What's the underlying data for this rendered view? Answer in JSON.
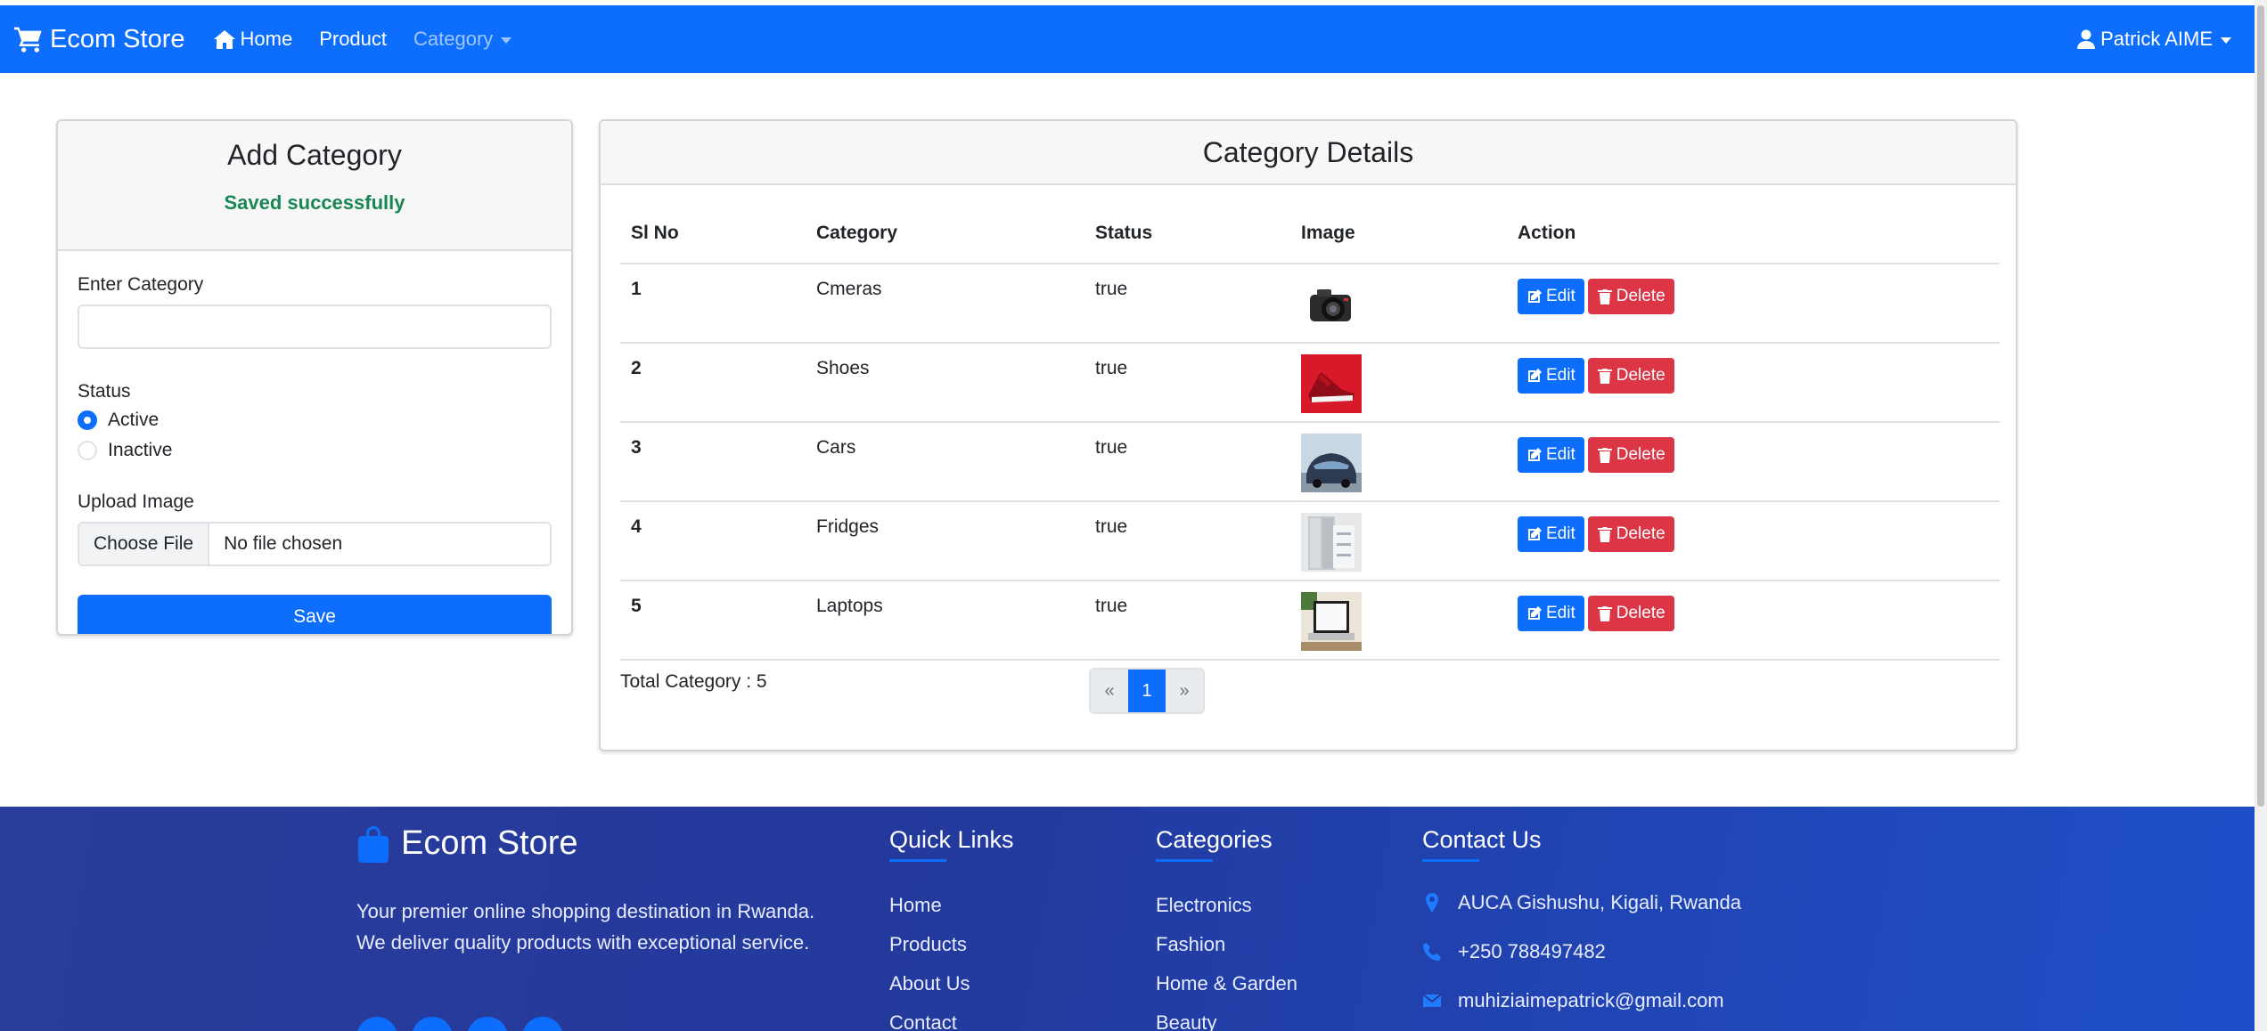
{
  "navbar": {
    "brand": "Ecom Store",
    "links": [
      {
        "label": "Home"
      },
      {
        "label": "Product"
      },
      {
        "label": "Category"
      }
    ],
    "user": "Patrick AIME"
  },
  "add_category": {
    "title": "Add Category",
    "message": "Saved successfully",
    "category_label": "Enter Category",
    "category_value": "",
    "status_label": "Status",
    "status_options": [
      "Active",
      "Inactive"
    ],
    "status_selected": "Active",
    "upload_label": "Upload Image",
    "file_button": "Choose File",
    "file_text": "No file chosen",
    "save_label": "Save"
  },
  "category_details": {
    "title": "Category Details",
    "columns": [
      "Sl No",
      "Category",
      "Status",
      "Image",
      "Action"
    ],
    "rows": [
      {
        "sl": "1",
        "category": "Cmeras",
        "status": "true",
        "image": "camera"
      },
      {
        "sl": "2",
        "category": "Shoes",
        "status": "true",
        "image": "shoe"
      },
      {
        "sl": "3",
        "category": "Cars",
        "status": "true",
        "image": "car"
      },
      {
        "sl": "4",
        "category": "Fridges",
        "status": "true",
        "image": "fridge"
      },
      {
        "sl": "5",
        "category": "Laptops",
        "status": "true",
        "image": "laptop"
      }
    ],
    "edit_label": "Edit",
    "delete_label": "Delete",
    "total_text": "Total Category : 5",
    "pagination": {
      "prev": "«",
      "current": "1",
      "next": "»"
    }
  },
  "footer": {
    "brand": "Ecom Store",
    "description": "Your premier online shopping destination in Rwanda. We deliver quality products with exceptional service.",
    "quick_links_title": "Quick Links",
    "quick_links": [
      "Home",
      "Products",
      "About Us",
      "Contact"
    ],
    "categories_title": "Categories",
    "categories": [
      "Electronics",
      "Fashion",
      "Home & Garden",
      "Beauty"
    ],
    "contact_title": "Contact Us",
    "address": "AUCA Gishushu, Kigali, Rwanda",
    "phone": "+250 788497482",
    "email": "muhiziaimepatrick@gmail.com"
  },
  "colors": {
    "primary": "#0d6efd",
    "danger": "#dc3545",
    "success": "#198754",
    "footer": "#23399c"
  }
}
